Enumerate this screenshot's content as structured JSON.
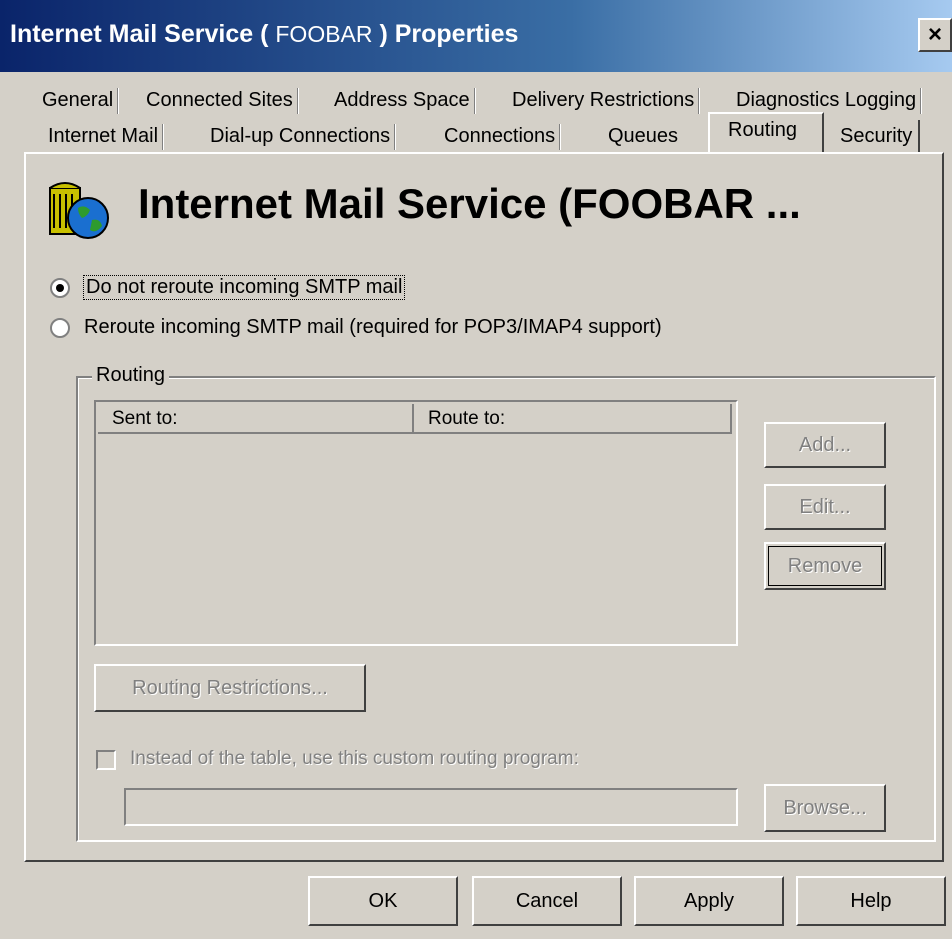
{
  "window": {
    "title_prefix": "Internet Mail Service ( ",
    "title_name": "FOOBAR",
    "title_suffix": " ) Properties",
    "close_label": "×"
  },
  "tabs_row1": [
    "General",
    "Connected Sites",
    "Address Space",
    "Delivery Restrictions",
    "Diagnostics Logging"
  ],
  "tabs_row2": [
    "Internet Mail",
    "Dial-up Connections",
    "Connections",
    "Queues",
    "Routing",
    "Security"
  ],
  "active_tab": "Routing",
  "header": {
    "title": "Internet Mail Service (FOOBAR ...",
    "icon": "internet-mail-globe-icon"
  },
  "options": {
    "no_reroute_label": "Do not reroute incoming SMTP mail",
    "reroute_label": "Reroute incoming SMTP mail (required for POP3/IMAP4 support)",
    "selected": "no_reroute"
  },
  "routing_group": {
    "label": "Routing",
    "columns": [
      "Sent to:",
      "Route to:"
    ],
    "rows": []
  },
  "buttons": {
    "add": "Add...",
    "edit": "Edit...",
    "remove": "Remove",
    "routing_restrictions": "Routing Restrictions...",
    "browse": "Browse..."
  },
  "custom_program": {
    "label": "Instead of the table, use this custom routing program:",
    "checked": false,
    "value": ""
  },
  "footer": {
    "ok": "OK",
    "cancel": "Cancel",
    "apply": "Apply",
    "help": "Help"
  }
}
